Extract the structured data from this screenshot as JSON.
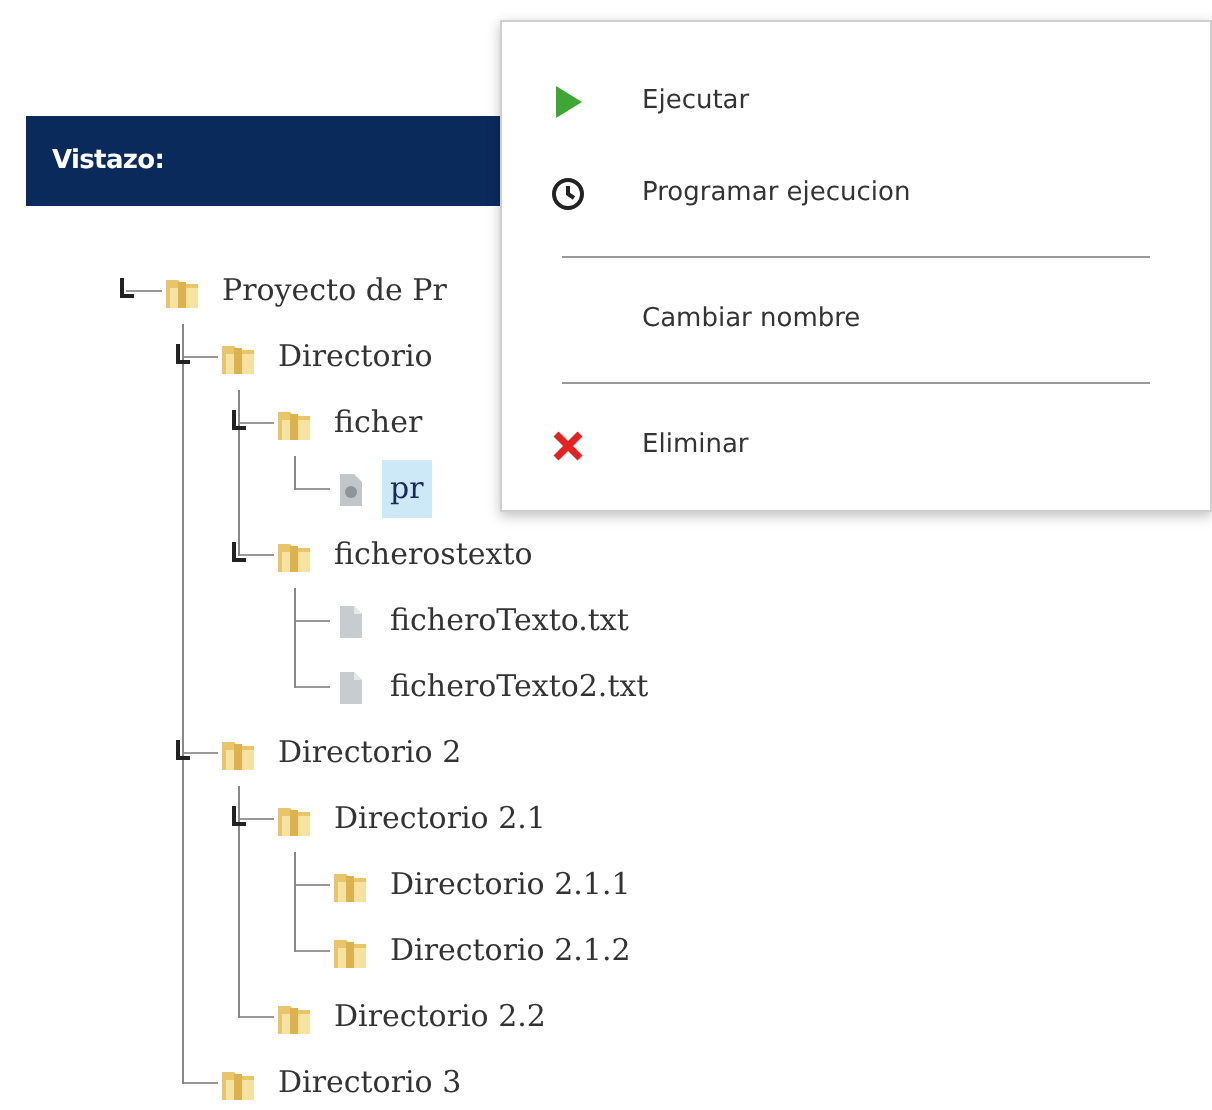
{
  "header": {
    "title": "Vistazo:"
  },
  "tree": [
    {
      "label": "Proyecto de Pr",
      "kind": "folder",
      "expanded": true,
      "selected": false,
      "children": [
        {
          "label": "Directorio",
          "kind": "folder",
          "expanded": true,
          "selected": false,
          "children": [
            {
              "label": "ficher",
              "kind": "folder",
              "expanded": true,
              "selected": false,
              "children": [
                {
                  "label": "pr",
                  "kind": "script",
                  "selected": true
                }
              ]
            },
            {
              "label": "ficherostexto",
              "kind": "folder",
              "expanded": true,
              "selected": false,
              "children": [
                {
                  "label": "ficheroTexto.txt",
                  "kind": "file",
                  "selected": false
                },
                {
                  "label": "ficheroTexto2.txt",
                  "kind": "file",
                  "selected": false
                }
              ]
            }
          ]
        },
        {
          "label": "Directorio 2",
          "kind": "folder",
          "expanded": true,
          "selected": false,
          "children": [
            {
              "label": "Directorio 2.1",
              "kind": "folder",
              "expanded": true,
              "selected": false,
              "children": [
                {
                  "label": "Directorio 2.1.1",
                  "kind": "folder",
                  "expanded": false,
                  "selected": false
                },
                {
                  "label": "Directorio 2.1.2",
                  "kind": "folder",
                  "expanded": false,
                  "selected": false
                }
              ]
            },
            {
              "label": "Directorio 2.2",
              "kind": "folder",
              "expanded": false,
              "selected": false
            }
          ]
        },
        {
          "label": "Directorio 3",
          "kind": "folder",
          "expanded": false,
          "selected": false
        }
      ]
    }
  ],
  "context_menu": {
    "items": [
      {
        "kind": "run",
        "label": "Ejecutar"
      },
      {
        "kind": "schedule",
        "label": "Programar ejecucion"
      },
      {
        "kind": "separator"
      },
      {
        "kind": "plain",
        "label": "Cambiar nombre"
      },
      {
        "kind": "separator"
      },
      {
        "kind": "delete",
        "label": "Eliminar"
      }
    ]
  }
}
